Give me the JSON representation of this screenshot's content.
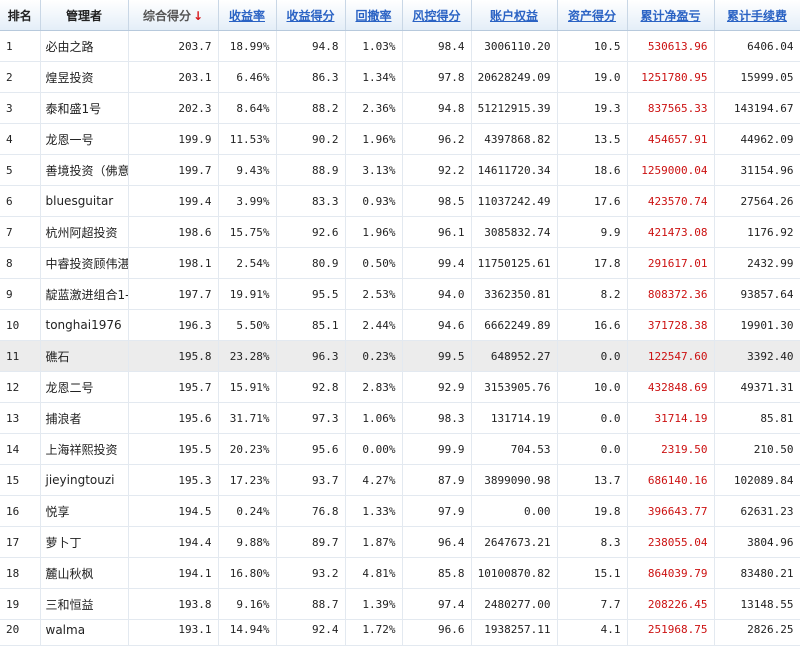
{
  "headers": {
    "rank": "排名",
    "manager": "管理者",
    "score": "综合得分",
    "sort_arrow": "↓",
    "return_rate": "收益率",
    "return_score": "收益得分",
    "drawdown": "回撤率",
    "risk_score": "风控得分",
    "equity": "账户权益",
    "asset_score": "资产得分",
    "cum_pnl": "累计净盈亏",
    "cum_fee": "累计手续费"
  },
  "colors": {
    "header_link": "#2b63c4",
    "pnl": "#cc1111",
    "sort_arrow": "#d7191c",
    "highlight_row": "#ececec"
  },
  "rows": [
    {
      "rank": "1",
      "manager": "必由之路",
      "score": "203.7",
      "return_rate": "18.99%",
      "return_score": "94.8",
      "drawdown": "1.03%",
      "risk_score": "98.4",
      "equity": "3006110.20",
      "asset_score": "10.5",
      "cum_pnl": "530613.96",
      "cum_fee": "6406.04"
    },
    {
      "rank": "2",
      "manager": "煌昱投资",
      "score": "203.1",
      "return_rate": "6.46%",
      "return_score": "86.3",
      "drawdown": "1.34%",
      "risk_score": "97.8",
      "equity": "20628249.09",
      "asset_score": "19.0",
      "cum_pnl": "1251780.95",
      "cum_fee": "15999.05"
    },
    {
      "rank": "3",
      "manager": "泰和盛1号",
      "score": "202.3",
      "return_rate": "8.64%",
      "return_score": "88.2",
      "drawdown": "2.36%",
      "risk_score": "94.8",
      "equity": "51212915.39",
      "asset_score": "19.3",
      "cum_pnl": "837565.33",
      "cum_fee": "143194.67"
    },
    {
      "rank": "4",
      "manager": "龙恩一号",
      "score": "199.9",
      "return_rate": "11.53%",
      "return_score": "90.2",
      "drawdown": "1.96%",
      "risk_score": "96.2",
      "equity": "4397868.82",
      "asset_score": "13.5",
      "cum_pnl": "454657.91",
      "cum_fee": "44962.09"
    },
    {
      "rank": "5",
      "manager": "善境投资（佛意",
      "score": "199.7",
      "return_rate": "9.43%",
      "return_score": "88.9",
      "drawdown": "3.13%",
      "risk_score": "92.2",
      "equity": "14611720.34",
      "asset_score": "18.6",
      "cum_pnl": "1259000.04",
      "cum_fee": "31154.96"
    },
    {
      "rank": "6",
      "manager": "bluesguitar",
      "score": "199.4",
      "return_rate": "3.99%",
      "return_score": "83.3",
      "drawdown": "0.93%",
      "risk_score": "98.5",
      "equity": "11037242.49",
      "asset_score": "17.6",
      "cum_pnl": "423570.74",
      "cum_fee": "27564.26"
    },
    {
      "rank": "7",
      "manager": "杭州阿超投资",
      "score": "198.6",
      "return_rate": "15.75%",
      "return_score": "92.6",
      "drawdown": "1.96%",
      "risk_score": "96.1",
      "equity": "3085832.74",
      "asset_score": "9.9",
      "cum_pnl": "421473.08",
      "cum_fee": "1176.92"
    },
    {
      "rank": "8",
      "manager": "中睿投资顾伟湛",
      "score": "198.1",
      "return_rate": "2.54%",
      "return_score": "80.9",
      "drawdown": "0.50%",
      "risk_score": "99.4",
      "equity": "11750125.61",
      "asset_score": "17.8",
      "cum_pnl": "291617.01",
      "cum_fee": "2432.99"
    },
    {
      "rank": "9",
      "manager": "靛蓝激进组合1-",
      "score": "197.7",
      "return_rate": "19.91%",
      "return_score": "95.5",
      "drawdown": "2.53%",
      "risk_score": "94.0",
      "equity": "3362350.81",
      "asset_score": "8.2",
      "cum_pnl": "808372.36",
      "cum_fee": "93857.64"
    },
    {
      "rank": "10",
      "manager": "tonghai1976",
      "score": "196.3",
      "return_rate": "5.50%",
      "return_score": "85.1",
      "drawdown": "2.44%",
      "risk_score": "94.6",
      "equity": "6662249.89",
      "asset_score": "16.6",
      "cum_pnl": "371728.38",
      "cum_fee": "19901.30"
    },
    {
      "rank": "11",
      "manager": "礁石",
      "score": "195.8",
      "return_rate": "23.28%",
      "return_score": "96.3",
      "drawdown": "0.23%",
      "risk_score": "99.5",
      "equity": "648952.27",
      "asset_score": "0.0",
      "cum_pnl": "122547.60",
      "cum_fee": "3392.40",
      "highlight": true
    },
    {
      "rank": "12",
      "manager": "龙恩二号",
      "score": "195.7",
      "return_rate": "15.91%",
      "return_score": "92.8",
      "drawdown": "2.83%",
      "risk_score": "92.9",
      "equity": "3153905.76",
      "asset_score": "10.0",
      "cum_pnl": "432848.69",
      "cum_fee": "49371.31"
    },
    {
      "rank": "13",
      "manager": "捕浪者",
      "score": "195.6",
      "return_rate": "31.71%",
      "return_score": "97.3",
      "drawdown": "1.06%",
      "risk_score": "98.3",
      "equity": "131714.19",
      "asset_score": "0.0",
      "cum_pnl": "31714.19",
      "cum_fee": "85.81"
    },
    {
      "rank": "14",
      "manager": "上海祥熙投资",
      "score": "195.5",
      "return_rate": "20.23%",
      "return_score": "95.6",
      "drawdown": "0.00%",
      "risk_score": "99.9",
      "equity": "704.53",
      "asset_score": "0.0",
      "cum_pnl": "2319.50",
      "cum_fee": "210.50"
    },
    {
      "rank": "15",
      "manager": "jieyingtouzi",
      "score": "195.3",
      "return_rate": "17.23%",
      "return_score": "93.7",
      "drawdown": "4.27%",
      "risk_score": "87.9",
      "equity": "3899090.98",
      "asset_score": "13.7",
      "cum_pnl": "686140.16",
      "cum_fee": "102089.84"
    },
    {
      "rank": "16",
      "manager": "悦享",
      "score": "194.5",
      "return_rate": "0.24%",
      "return_score": "76.8",
      "drawdown": "1.33%",
      "risk_score": "97.9",
      "equity": "0.00",
      "asset_score": "19.8",
      "cum_pnl": "396643.77",
      "cum_fee": "62631.23"
    },
    {
      "rank": "17",
      "manager": "萝卜丁",
      "score": "194.4",
      "return_rate": "9.88%",
      "return_score": "89.7",
      "drawdown": "1.87%",
      "risk_score": "96.4",
      "equity": "2647673.21",
      "asset_score": "8.3",
      "cum_pnl": "238055.04",
      "cum_fee": "3804.96"
    },
    {
      "rank": "18",
      "manager": "麓山秋枫",
      "score": "194.1",
      "return_rate": "16.80%",
      "return_score": "93.2",
      "drawdown": "4.81%",
      "risk_score": "85.8",
      "equity": "10100870.82",
      "asset_score": "15.1",
      "cum_pnl": "864039.79",
      "cum_fee": "83480.21"
    },
    {
      "rank": "19",
      "manager": "三和恒益",
      "score": "193.8",
      "return_rate": "9.16%",
      "return_score": "88.7",
      "drawdown": "1.39%",
      "risk_score": "97.4",
      "equity": "2480277.00",
      "asset_score": "7.7",
      "cum_pnl": "208226.45",
      "cum_fee": "13148.55"
    },
    {
      "rank": "20",
      "manager": "walma",
      "score": "193.1",
      "return_rate": "14.94%",
      "return_score": "92.4",
      "drawdown": "1.72%",
      "risk_score": "96.6",
      "equity": "1938257.11",
      "asset_score": "4.1",
      "cum_pnl": "251968.75",
      "cum_fee": "2826.25"
    }
  ]
}
